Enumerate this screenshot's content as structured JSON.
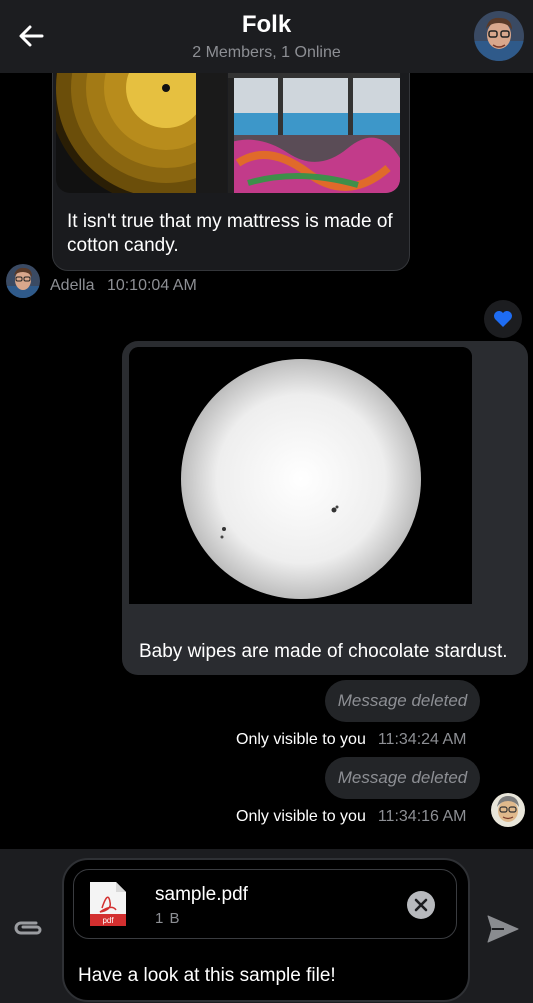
{
  "header": {
    "title": "Folk",
    "subtitle": "2 Members, 1 Online",
    "back_icon": "arrow-left-icon",
    "bg_color": "#1c1d20"
  },
  "messages": {
    "incoming": {
      "text": "It isn't true that my mattress is made of cotton candy.",
      "sender": "Adella",
      "time": "10:10:04 AM",
      "images": [
        "vinyl-record-image",
        "graffiti-lake-image"
      ]
    },
    "reaction": {
      "icon": "heart-icon",
      "color": "#1e6cf2"
    },
    "outgoing_image": {
      "text": "Baby wipes are made of chocolate stardust.",
      "image": "sun-sunspots-image"
    },
    "deleted_1": {
      "label": "Message deleted",
      "visibility": "Only visible to you",
      "time": "11:34:24 AM"
    },
    "deleted_2": {
      "label": "Message deleted",
      "visibility": "Only visible to you",
      "time": "11:34:16 AM"
    }
  },
  "composer": {
    "attachment": {
      "name": "sample.pdf",
      "size": "1 B",
      "type_label": "pdf"
    },
    "input_value": "Have a look at this sample file!",
    "attach_icon": "paperclip-icon",
    "send_icon": "send-icon"
  },
  "colors": {
    "background": "#000000",
    "bubble_dark": "#2a2c30",
    "muted_text": "#8d8f94",
    "accent_blue": "#1e6cf2",
    "pdf_red": "#d32f2f"
  }
}
